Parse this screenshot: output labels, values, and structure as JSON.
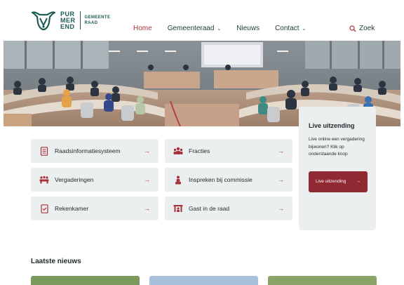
{
  "logo": {
    "word_lines": [
      "PUR",
      "MER",
      "END"
    ],
    "sub_lines": [
      "GEMEENTE",
      "RAAD"
    ]
  },
  "nav": {
    "home": "Home",
    "gemeenteraad": "Gemeenteraad",
    "nieuws": "Nieuws",
    "contact": "Contact",
    "search": "Zoek"
  },
  "cards": [
    {
      "label": "Raadsinformatiesysteem",
      "icon": "document-list-icon"
    },
    {
      "label": "Fracties",
      "icon": "people-group-icon"
    },
    {
      "label": "Vergaderingen",
      "icon": "meeting-icon"
    },
    {
      "label": "Inspreken bij commissie",
      "icon": "speaker-person-icon"
    },
    {
      "label": "Rekenkamer",
      "icon": "book-check-icon"
    },
    {
      "label": "Gast in de raad",
      "icon": "guest-seats-icon"
    }
  ],
  "live": {
    "title": "Live uitzending",
    "text": "Live online een vergadering bijwonen? Klik op onderstaande knop",
    "button": "Live uitzending"
  },
  "news": {
    "title": "Laatste nieuws"
  },
  "colors": {
    "brand_green": "#1c5c54",
    "accent_red": "#a6333a",
    "button_red": "#8f2a33",
    "card_bg": "#ecefef"
  }
}
